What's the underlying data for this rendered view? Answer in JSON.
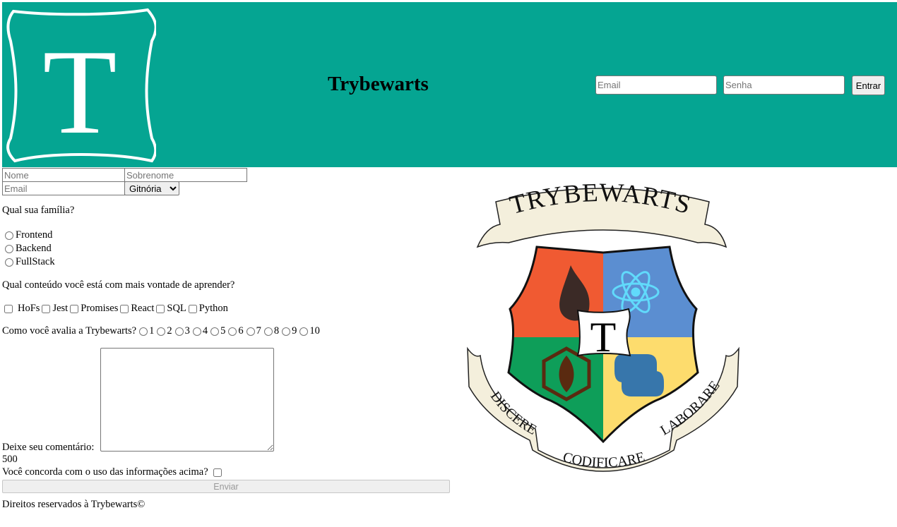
{
  "header": {
    "logo_letter": "T",
    "brand": "Trybewarts",
    "email_placeholder": "Email",
    "password_placeholder": "Senha",
    "login_label": "Entrar"
  },
  "form": {
    "name_placeholder": "Nome",
    "lastname_placeholder": "Sobrenome",
    "email_placeholder": "Email",
    "house_selected": "Gitnória",
    "family_question": "Qual sua família?",
    "families": [
      "Frontend",
      "Backend",
      "FullStack"
    ],
    "subject_question": "Qual conteúdo você está com mais vontade de aprender?",
    "subjects": [
      "HoFs",
      "Jest",
      "Promises",
      "React",
      "SQL",
      "Python"
    ],
    "rate_question": "Como você avalia a Trybewarts?",
    "rates": [
      "1",
      "2",
      "3",
      "4",
      "5",
      "6",
      "7",
      "8",
      "9",
      "10"
    ],
    "comment_label": "Deixe seu comentário:",
    "counter": "500",
    "agreement": "Você concorda com o uso das informações acima?",
    "submit_label": "Enviar"
  },
  "crest": {
    "top_banner": "TRYBEWARTS",
    "center_letter": "T",
    "left_banner": "DISCERE",
    "bottom_banner": "CODIFICARE",
    "right_banner": "LABORARE"
  },
  "footer": {
    "text": "Direitos reservados à Trybewarts©"
  },
  "colors": {
    "header_bg": "#05a592",
    "crest_red": "#f05a32",
    "crest_blue": "#5b8ed1",
    "crest_green": "#0e9e59",
    "crest_yellow": "#fddc6d",
    "banner": "#f4efdc"
  }
}
